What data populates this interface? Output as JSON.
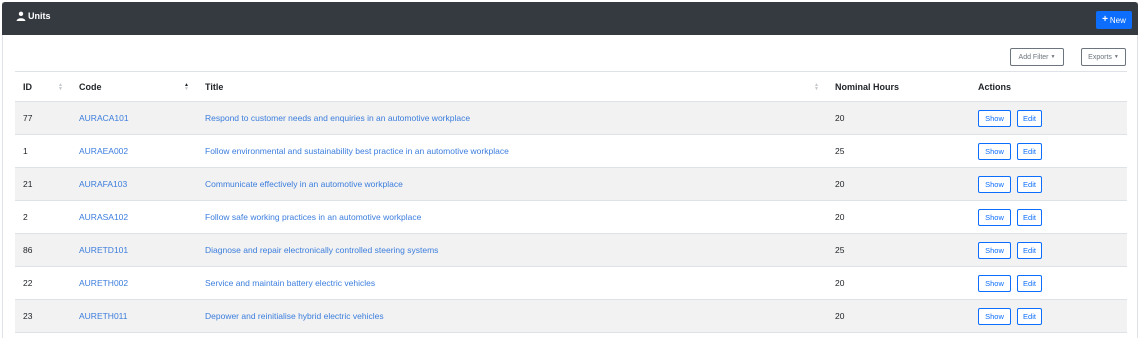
{
  "header": {
    "title": "Units",
    "new_label": "New"
  },
  "toolbar": {
    "filter_label": "Add Filter",
    "exports_label": "Exports"
  },
  "table": {
    "columns": [
      "ID",
      "Code",
      "Title",
      "Nominal Hours",
      "Actions"
    ],
    "sort": {
      "column": "Code",
      "direction": "asc"
    },
    "rows": [
      {
        "id": "77",
        "code": "AURACA101",
        "title": "Respond to customer needs and enquiries in an automotive workplace",
        "hours": "20"
      },
      {
        "id": "1",
        "code": "AURAEA002",
        "title": "Follow environmental and sustainability best practice in an automotive workplace",
        "hours": "25"
      },
      {
        "id": "21",
        "code": "AURAFA103",
        "title": "Communicate effectively in an automotive workplace",
        "hours": "20"
      },
      {
        "id": "2",
        "code": "AURASA102",
        "title": "Follow safe working practices in an automotive workplace",
        "hours": "20"
      },
      {
        "id": "86",
        "code": "AURETD101",
        "title": "Diagnose and repair electronically controlled steering systems",
        "hours": "25"
      },
      {
        "id": "22",
        "code": "AURETH002",
        "title": "Service and maintain battery electric vehicles",
        "hours": "20"
      },
      {
        "id": "23",
        "code": "AURETH011",
        "title": "Depower and reinitialise hybrid electric vehicles",
        "hours": "20"
      }
    ],
    "show_label": "Show",
    "edit_label": "Edit"
  },
  "colors": {
    "header_bg": "#343a40",
    "primary": "#0d6efd",
    "link": "#3b7ddd",
    "stripe": "#f2f2f2"
  },
  "icons": {
    "title_icon": "user-icon",
    "new_icon": "plus-icon",
    "sort_icon": "sort-arrows-icon",
    "dropdown_icon": "caret-down-icon"
  }
}
